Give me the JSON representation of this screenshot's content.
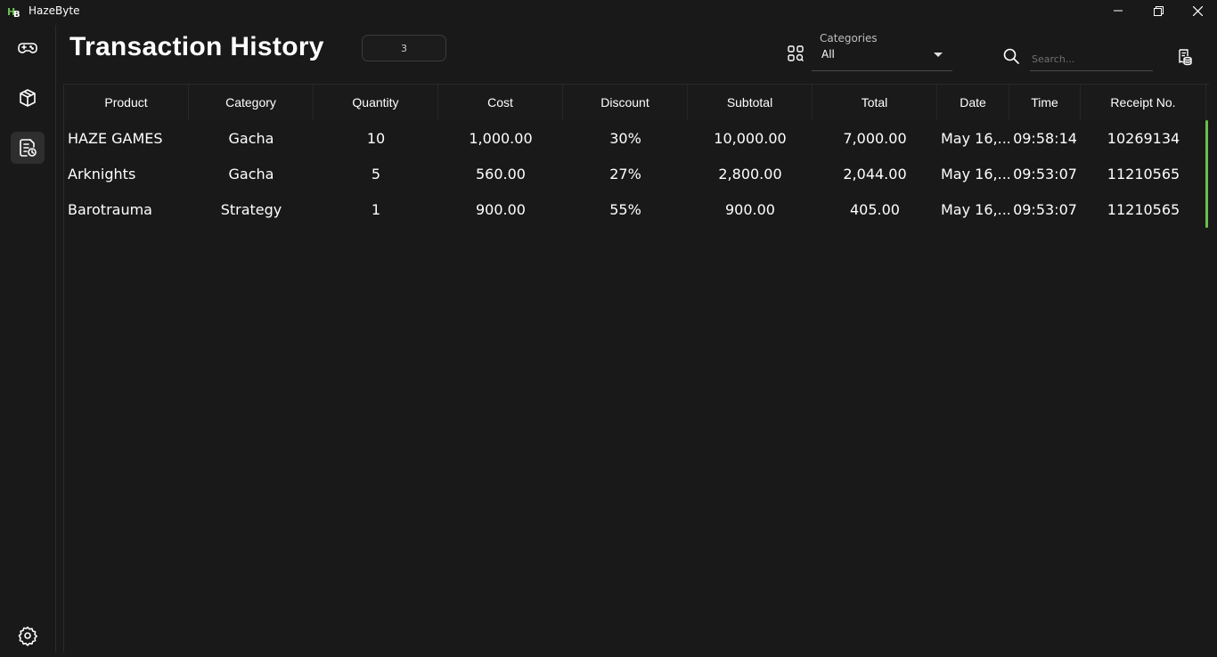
{
  "window": {
    "title": "HazeByte",
    "logo_text": "HB"
  },
  "sidebar": {
    "items": [
      {
        "icon": "gamepad-icon",
        "label": "Games"
      },
      {
        "icon": "box-icon",
        "label": "Store"
      },
      {
        "icon": "receipt-history-icon",
        "label": "Transaction History",
        "active": true
      },
      {
        "icon": "gear-icon",
        "label": "Settings"
      }
    ]
  },
  "header": {
    "title": "Transaction History",
    "count": "3"
  },
  "filters": {
    "categories_label": "Categories",
    "categories_value": "All",
    "search_placeholder": "Search..."
  },
  "table": {
    "columns": [
      "Product",
      "Category",
      "Quantity",
      "Cost",
      "Discount",
      "Subtotal",
      "Total",
      "Date",
      "Time",
      "Receipt No."
    ],
    "rows": [
      [
        "HAZE GAMES",
        "Gacha",
        "10",
        "1,000.00",
        "30%",
        "10,000.00",
        "7,000.00",
        "May 16,...",
        "09:58:14",
        "10269134"
      ],
      [
        "Arknights",
        "Gacha",
        "5",
        "560.00",
        "27%",
        "2,800.00",
        "2,044.00",
        "May 16,...",
        "09:53:07",
        "11210565"
      ],
      [
        "Barotrauma",
        "Strategy",
        "1",
        "900.00",
        "55%",
        "900.00",
        "405.00",
        "May 16,...",
        "09:53:07",
        "11210565"
      ]
    ]
  },
  "colors": {
    "background": "#191919",
    "accent": "#6bbf4e",
    "text": "#ffffff"
  }
}
